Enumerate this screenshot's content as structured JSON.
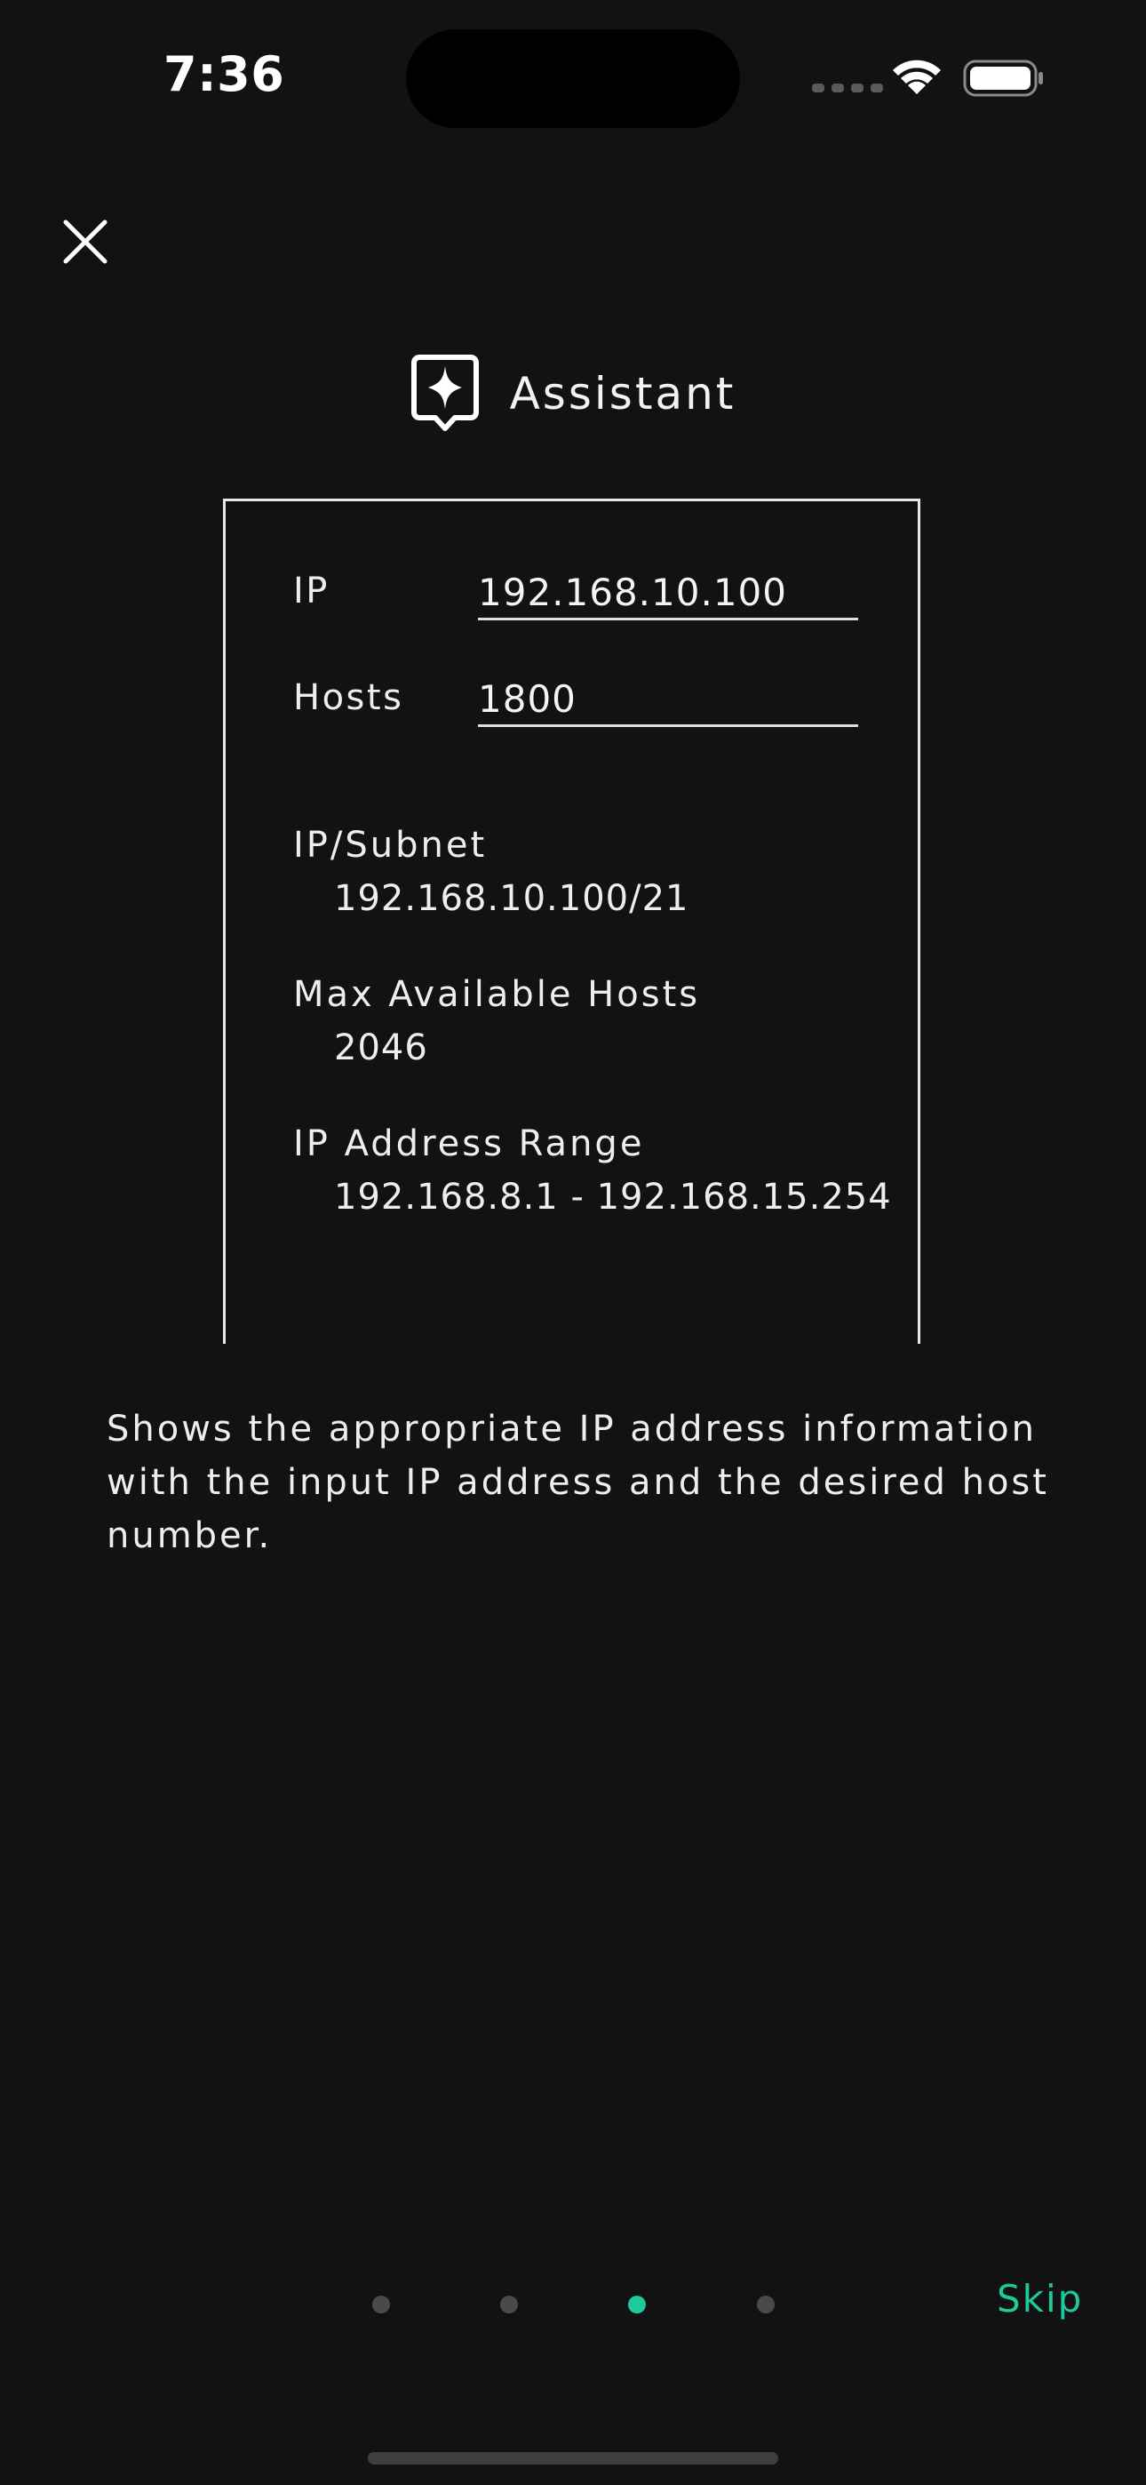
{
  "status_bar": {
    "time": "7:36"
  },
  "header": {
    "title": "Assistant",
    "title_icon": "assistant-sparkle-icon",
    "close_icon": "close-icon"
  },
  "card": {
    "ip_label": "IP",
    "ip_value": "192.168.10.100",
    "hosts_label": "Hosts",
    "hosts_value": "1800",
    "results": [
      {
        "label": "IP/Subnet",
        "value": "192.168.10.100/21"
      },
      {
        "label": "Max Available Hosts",
        "value": "2046"
      },
      {
        "label": "IP Address Range",
        "value": "192.168.8.1 - 192.168.15.254"
      }
    ]
  },
  "description": "Shows the appropriate IP address information with the input IP address and the desired host number.",
  "pager": {
    "page_count": 4,
    "current_page": 3,
    "skip_label": "Skip"
  },
  "colors": {
    "background": "#121212",
    "foreground": "#f2f2f2",
    "accent": "#1ec99c",
    "inactive_dot": "#4a4a4a"
  }
}
